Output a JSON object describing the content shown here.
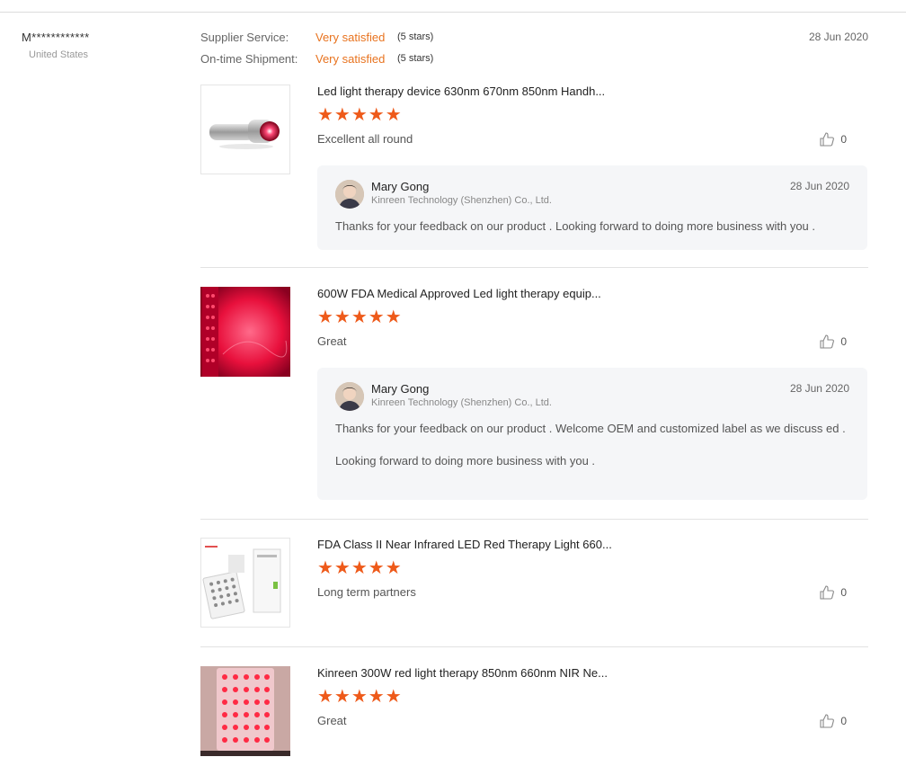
{
  "buyer": {
    "name": "M************",
    "country": "United States"
  },
  "supplier_ratings": [
    {
      "label": "Supplier Service:",
      "value": "Very satisfied",
      "stars_text": "(5 stars)"
    },
    {
      "label": "On-time Shipment:",
      "value": "Very satisfied",
      "stars_text": "(5 stars)"
    }
  ],
  "review_date": "28 Jun 2020",
  "star_rating": 5,
  "colors": {
    "accent_orange": "#e8731f",
    "star": "#ee5a1a",
    "reply_bg": "#f5f6f8"
  },
  "items": [
    {
      "title": "Led light therapy device 630nm 670nm 850nm Handh...",
      "stars": "★★★★★",
      "comment": "Excellent all round",
      "likes": "0",
      "image_icon": "handheld-led-device-photo",
      "reply": {
        "name": "Mary Gong",
        "company": "Kinreen Technology (Shenzhen) Co., Ltd.",
        "date": "28 Jun 2020",
        "text": [
          "Thanks for your feedback on our product . Looking forward to doing more business with you ."
        ]
      }
    },
    {
      "title": "600W FDA Medical Approved Led light therapy equip...",
      "stars": "★★★★★",
      "comment": "Great",
      "likes": "0",
      "image_icon": "red-light-panel-photo",
      "reply": {
        "name": "Mary Gong",
        "company": "Kinreen Technology (Shenzhen) Co., Ltd.",
        "date": "28 Jun 2020",
        "text": [
          "Thanks for your feedback on our product . Welcome OEM and customized label as we discuss ed .",
          "Looking forward to doing more business with you ."
        ]
      }
    },
    {
      "title": "FDA Class II Near Infrared LED Red Therapy Light 660...",
      "stars": "★★★★★",
      "comment": "Long term partners",
      "likes": "0",
      "image_icon": "led-panel-product-photo"
    },
    {
      "title": "Kinreen 300W red light therapy 850nm 660nm NIR Ne...",
      "stars": "★★★★★",
      "comment": "Great",
      "likes": "0",
      "image_icon": "red-led-panel-photo"
    }
  ]
}
